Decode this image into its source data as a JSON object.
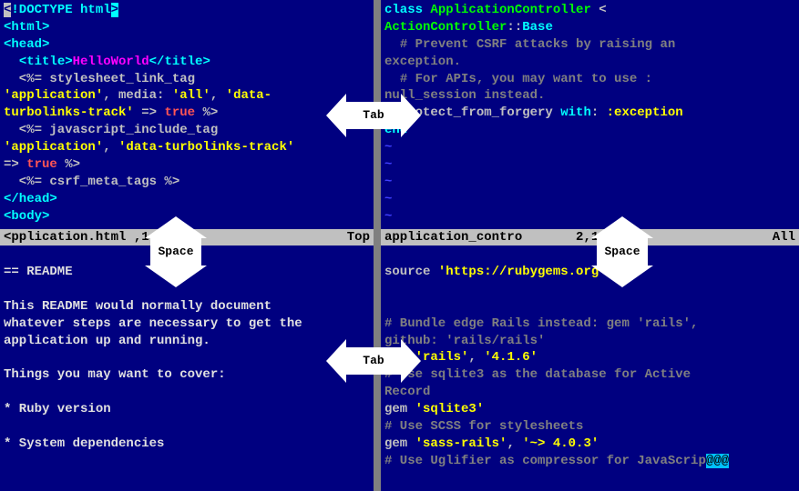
{
  "panes": {
    "tl": {
      "status_file": "pplication.html",
      "status_pos": ",1",
      "status_side": "Top",
      "html": "<span class='line'><span class='sel'>&lt;</span><span class='cyan'>!DOCTYPE html</span><span class='cursor'>&gt;</span></span>\n<span class='line'><span class='cyan'>&lt;html&gt;</span></span>\n<span class='line'><span class='cyan'>&lt;head&gt;</span></span>\n<span class='line'>  <span class='cyan'>&lt;title&gt;</span><span class='magenta'>HelloWorld</span><span class='cyan'>&lt;/title&gt;</span></span>\n<span class='line'>  &lt;%= stylesheet_link_tag</span>\n<span class='line'><span class='yellow'>'application'</span>, media: <span class='yellow'>'all'</span>, <span class='yellow'>'data-</span></span>\n<span class='line'><span class='yellow'>turbolinks-track'</span> =&gt; <span class='red'>true</span> %&gt;</span>\n<span class='line'>  &lt;%= javascript_include_tag</span>\n<span class='line'><span class='yellow'>'application'</span>, <span class='yellow'>'data-turbolinks-track'</span></span>\n<span class='line'>=&gt; <span class='red'>true</span> %&gt;</span>\n<span class='line'>  &lt;%= csrf_meta_tags %&gt;</span>\n<span class='line'><span class='cyan'>&lt;/head&gt;</span></span>\n<span class='line'><span class='cyan'>&lt;body&gt;</span></span>"
    },
    "tr": {
      "status_file": "application_contro",
      "status_pos": "2,1",
      "status_side": "All",
      "html": "<span class='line'><span class='cyan'>class</span> <span class='green'>ApplicationController</span> &lt;</span>\n<span class='line'><span class='green'>ActionController</span>::<span class='cyan'>Base</span></span>\n<span class='line'>  <span class='gray'># Prevent CSRF attacks by raising an</span></span>\n<span class='line'><span class='gray'>exception.</span></span>\n<span class='line'>  <span class='gray'># For APIs, you may want to use :</span></span>\n<span class='line'><span class='gray'>null_session instead.</span></span>\n<span class='line'>  protect_from_forgery <span class='cyan'>with</span>: <span class='yellow'>:exception</span></span>\n<span class='line'><span class='cyan'>end</span></span>\n<span class='line tilde'>~</span>\n<span class='line tilde'>~</span>\n<span class='line tilde'>~</span>\n<span class='line tilde'>~</span>\n<span class='line tilde'>~</span>"
    },
    "bl": {
      "html": "<span class='line ltgray'>== README</span>\n<span class='line'> </span>\n<span class='line ltgray'>This README would normally document</span>\n<span class='line ltgray'>whatever steps are necessary to get the</span>\n<span class='line ltgray'>application up and running.</span>\n<span class='line'> </span>\n<span class='line ltgray'>Things you may want to cover:</span>\n<span class='line'> </span>\n<span class='line ltgray'>* Ruby version</span>\n<span class='line'> </span>\n<span class='line ltgray'>* System dependencies</span>"
    },
    "br": {
      "html": "<span class='line'>source <span class='yellow'>'https://rubygems.org'</span></span>\n<span class='line'> </span>\n<span class='line'> </span>\n<span class='line'><span class='gray'># Bundle edge Rails instead: gem 'rails',</span></span>\n<span class='line'><span class='gray'>github: 'rails/rails'</span></span>\n<span class='line'>gem <span class='yellow'>'rails'</span>, <span class='yellow'>'4.1.6'</span></span>\n<span class='line'><span class='gray'># Use sqlite3 as the database for Active</span></span>\n<span class='line'><span class='gray'>Record</span></span>\n<span class='line'>gem <span class='yellow'>'sqlite3'</span></span>\n<span class='line'><span class='gray'># Use SCSS for stylesheets</span></span>\n<span class='line'>gem <span class='yellow'>'sass-rails'</span>, <span class='yellow'>'~&gt; 4.0.3'</span></span>\n<span class='line'><span class='gray'># Use Uglifier as compressor for JavaScrip</span><span class='botcursor'>@@@</span></span>"
    }
  },
  "arrows": {
    "tab_top": "Tab",
    "tab_bottom": "Tab",
    "space_left": "Space",
    "space_right": "Space"
  }
}
